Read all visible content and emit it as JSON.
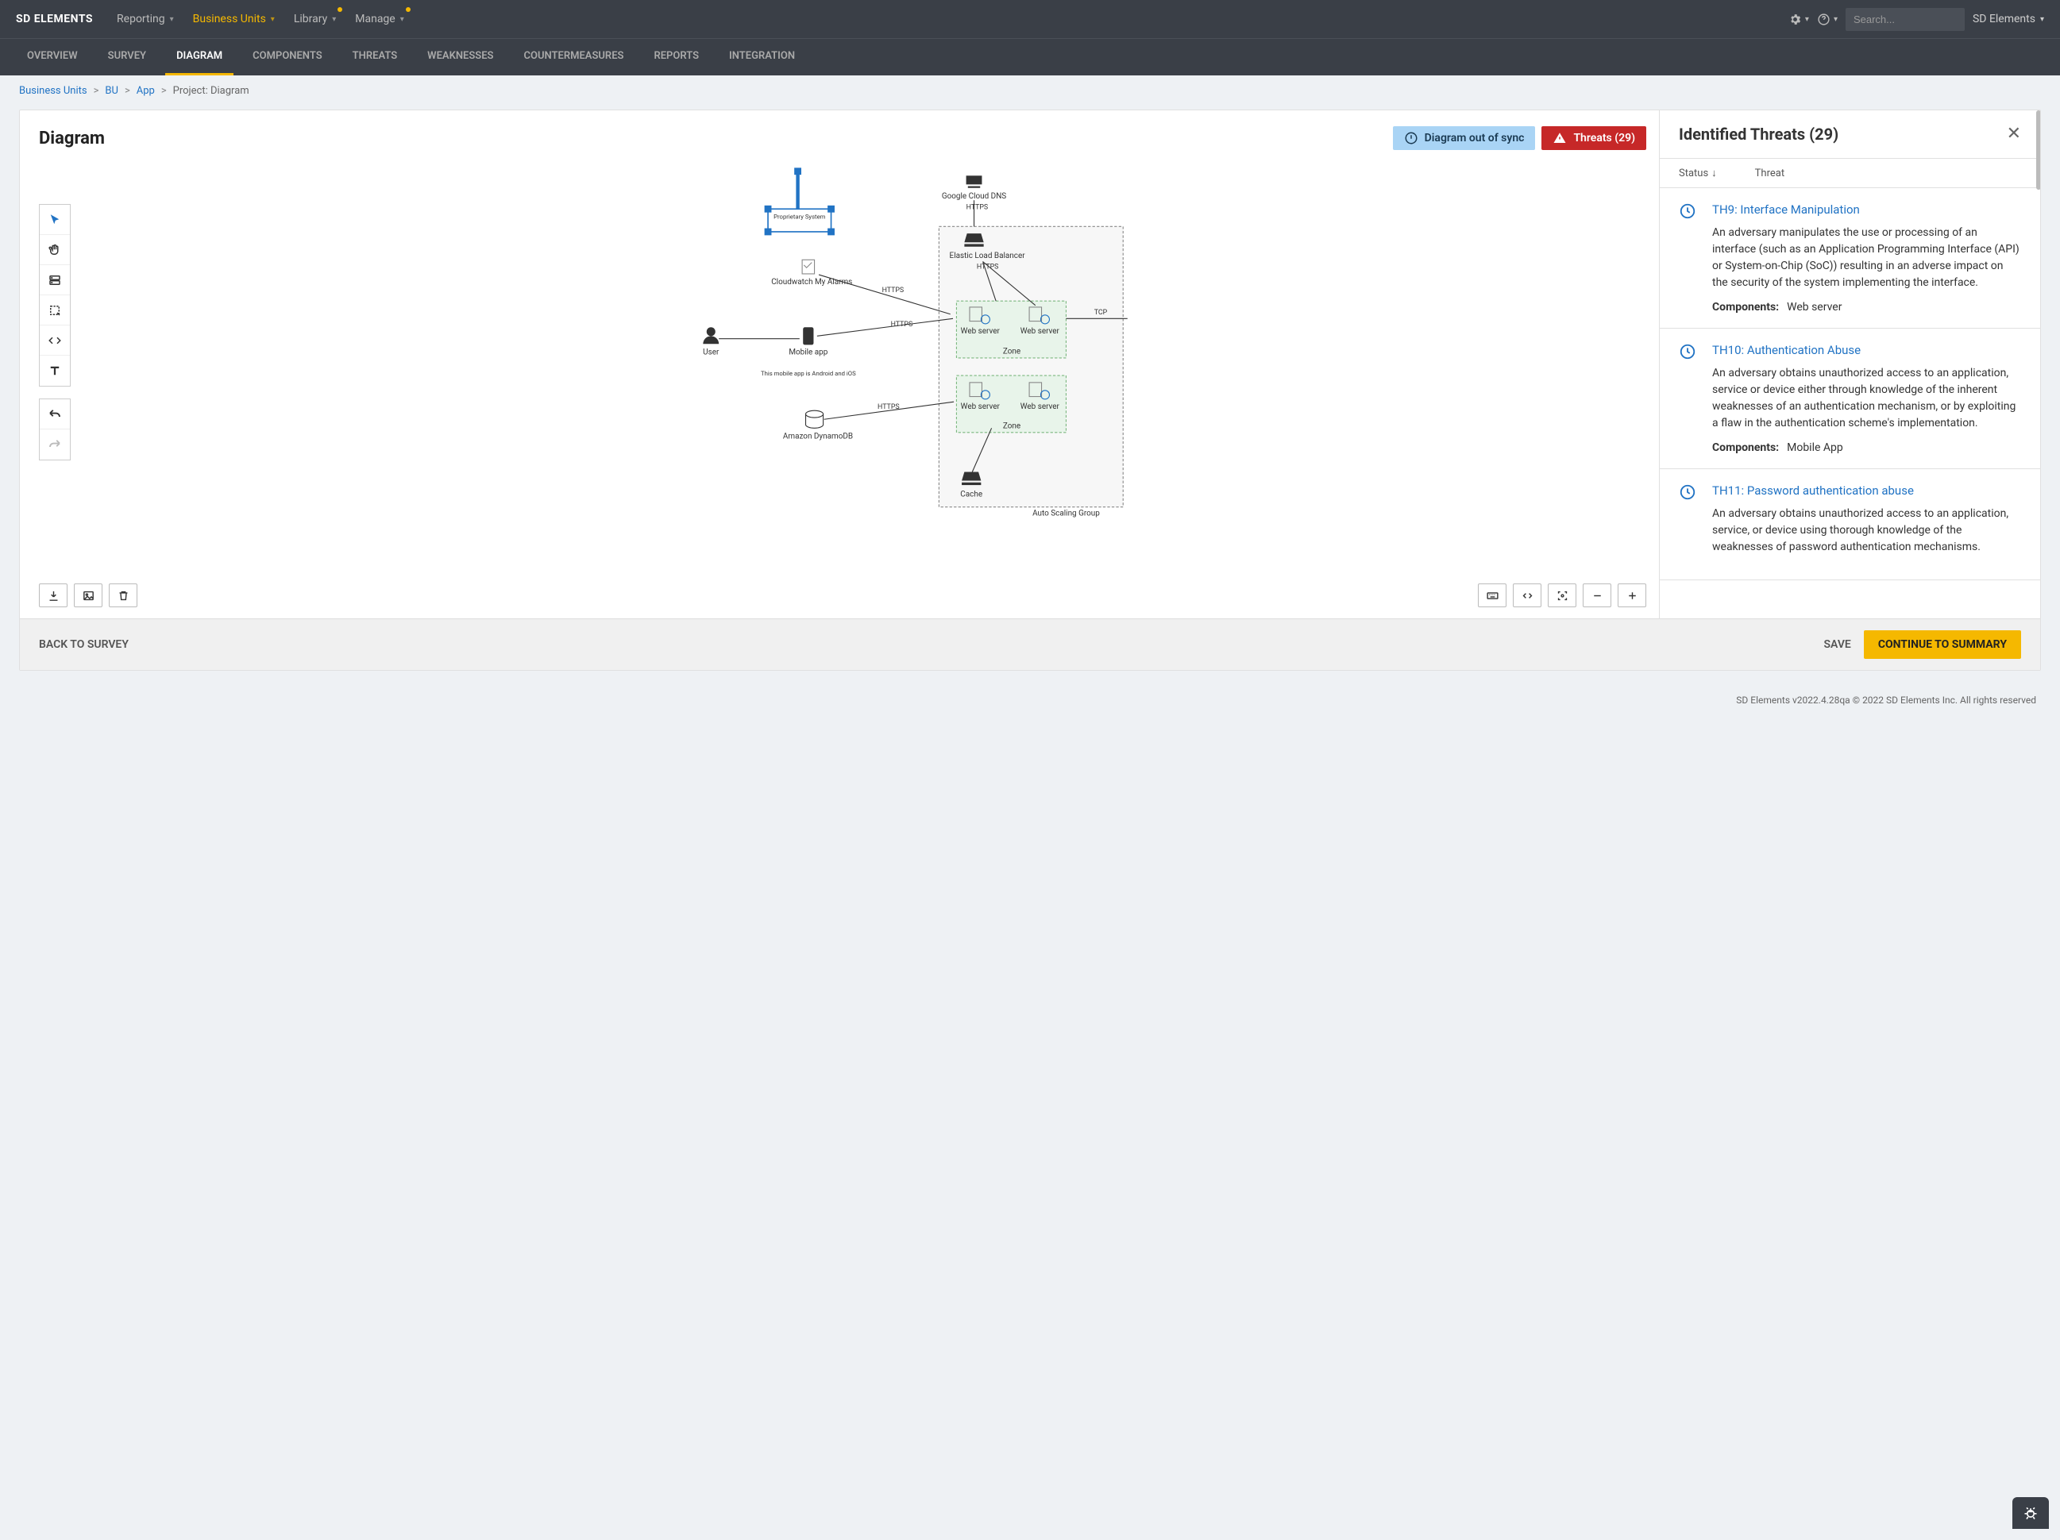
{
  "brand": "SD ELEMENTS",
  "topnav": [
    {
      "label": "Reporting",
      "active": false,
      "dot": false
    },
    {
      "label": "Business Units",
      "active": true,
      "dot": false
    },
    {
      "label": "Library",
      "active": false,
      "dot": true
    },
    {
      "label": "Manage",
      "active": false,
      "dot": true
    }
  ],
  "search_placeholder": "Search...",
  "user_label": "SD Elements",
  "subnav": [
    {
      "label": "OVERVIEW",
      "active": false
    },
    {
      "label": "SURVEY",
      "active": false
    },
    {
      "label": "DIAGRAM",
      "active": true
    },
    {
      "label": "COMPONENTS",
      "active": false
    },
    {
      "label": "THREATS",
      "active": false
    },
    {
      "label": "WEAKNESSES",
      "active": false
    },
    {
      "label": "COUNTERMEASURES",
      "active": false
    },
    {
      "label": "REPORTS",
      "active": false
    },
    {
      "label": "INTEGRATION",
      "active": false
    }
  ],
  "breadcrumbs": {
    "a": "Business Units",
    "b": "BU",
    "c": "App",
    "current": "Project: Diagram"
  },
  "diagram_title": "Diagram",
  "badge_sync": "Diagram out of sync",
  "badge_threats": "Threats (29)",
  "panel_title": "Identified Threats (29)",
  "cols": {
    "status": "Status",
    "threat": "Threat"
  },
  "threats": [
    {
      "title": "TH9: Interface Manipulation",
      "desc": "An adversary manipulates the use or processing of an interface (such as an Application Programming Interface (API) or System-on-Chip (SoC)) resulting in an adverse impact on the security of the system implementing the interface.",
      "comp_label": "Components:",
      "comp_value": "Web server"
    },
    {
      "title": "TH10: Authentication Abuse",
      "desc": "An adversary obtains unauthorized access to an application, service or device either through knowledge of the inherent weaknesses of an authentication mechanism, or by exploiting a flaw in the authentication scheme's implementation.",
      "comp_label": "Components:",
      "comp_value": "Mobile App"
    },
    {
      "title": "TH11: Password authentication abuse",
      "desc": "An adversary obtains unauthorized access to an application, service, or device using thorough knowledge of the weaknesses of password authentication mechanisms.",
      "comp_label": "",
      "comp_value": ""
    }
  ],
  "diagram_nodes": {
    "proprietary": "Proprietary System",
    "dns": "Google Cloud DNS",
    "elb": "Elastic Load Balancer",
    "cloudwatch": "Cloudwatch My Alarms",
    "user": "User",
    "mobile": "Mobile app",
    "mobile_note": "This mobile app is Android and iOS",
    "dynamo": "Amazon DynamoDB",
    "web": "Web server",
    "zone": "Zone",
    "cache": "Cache",
    "asg": "Auto Scaling Group",
    "https": "HTTPS",
    "tcp": "TCP"
  },
  "action_bar": {
    "back": "BACK TO SURVEY",
    "save": "SAVE",
    "continue": "CONTINUE TO SUMMARY"
  },
  "footer": "SD Elements v2022.4.28qa © 2022 SD Elements Inc. All rights reserved"
}
